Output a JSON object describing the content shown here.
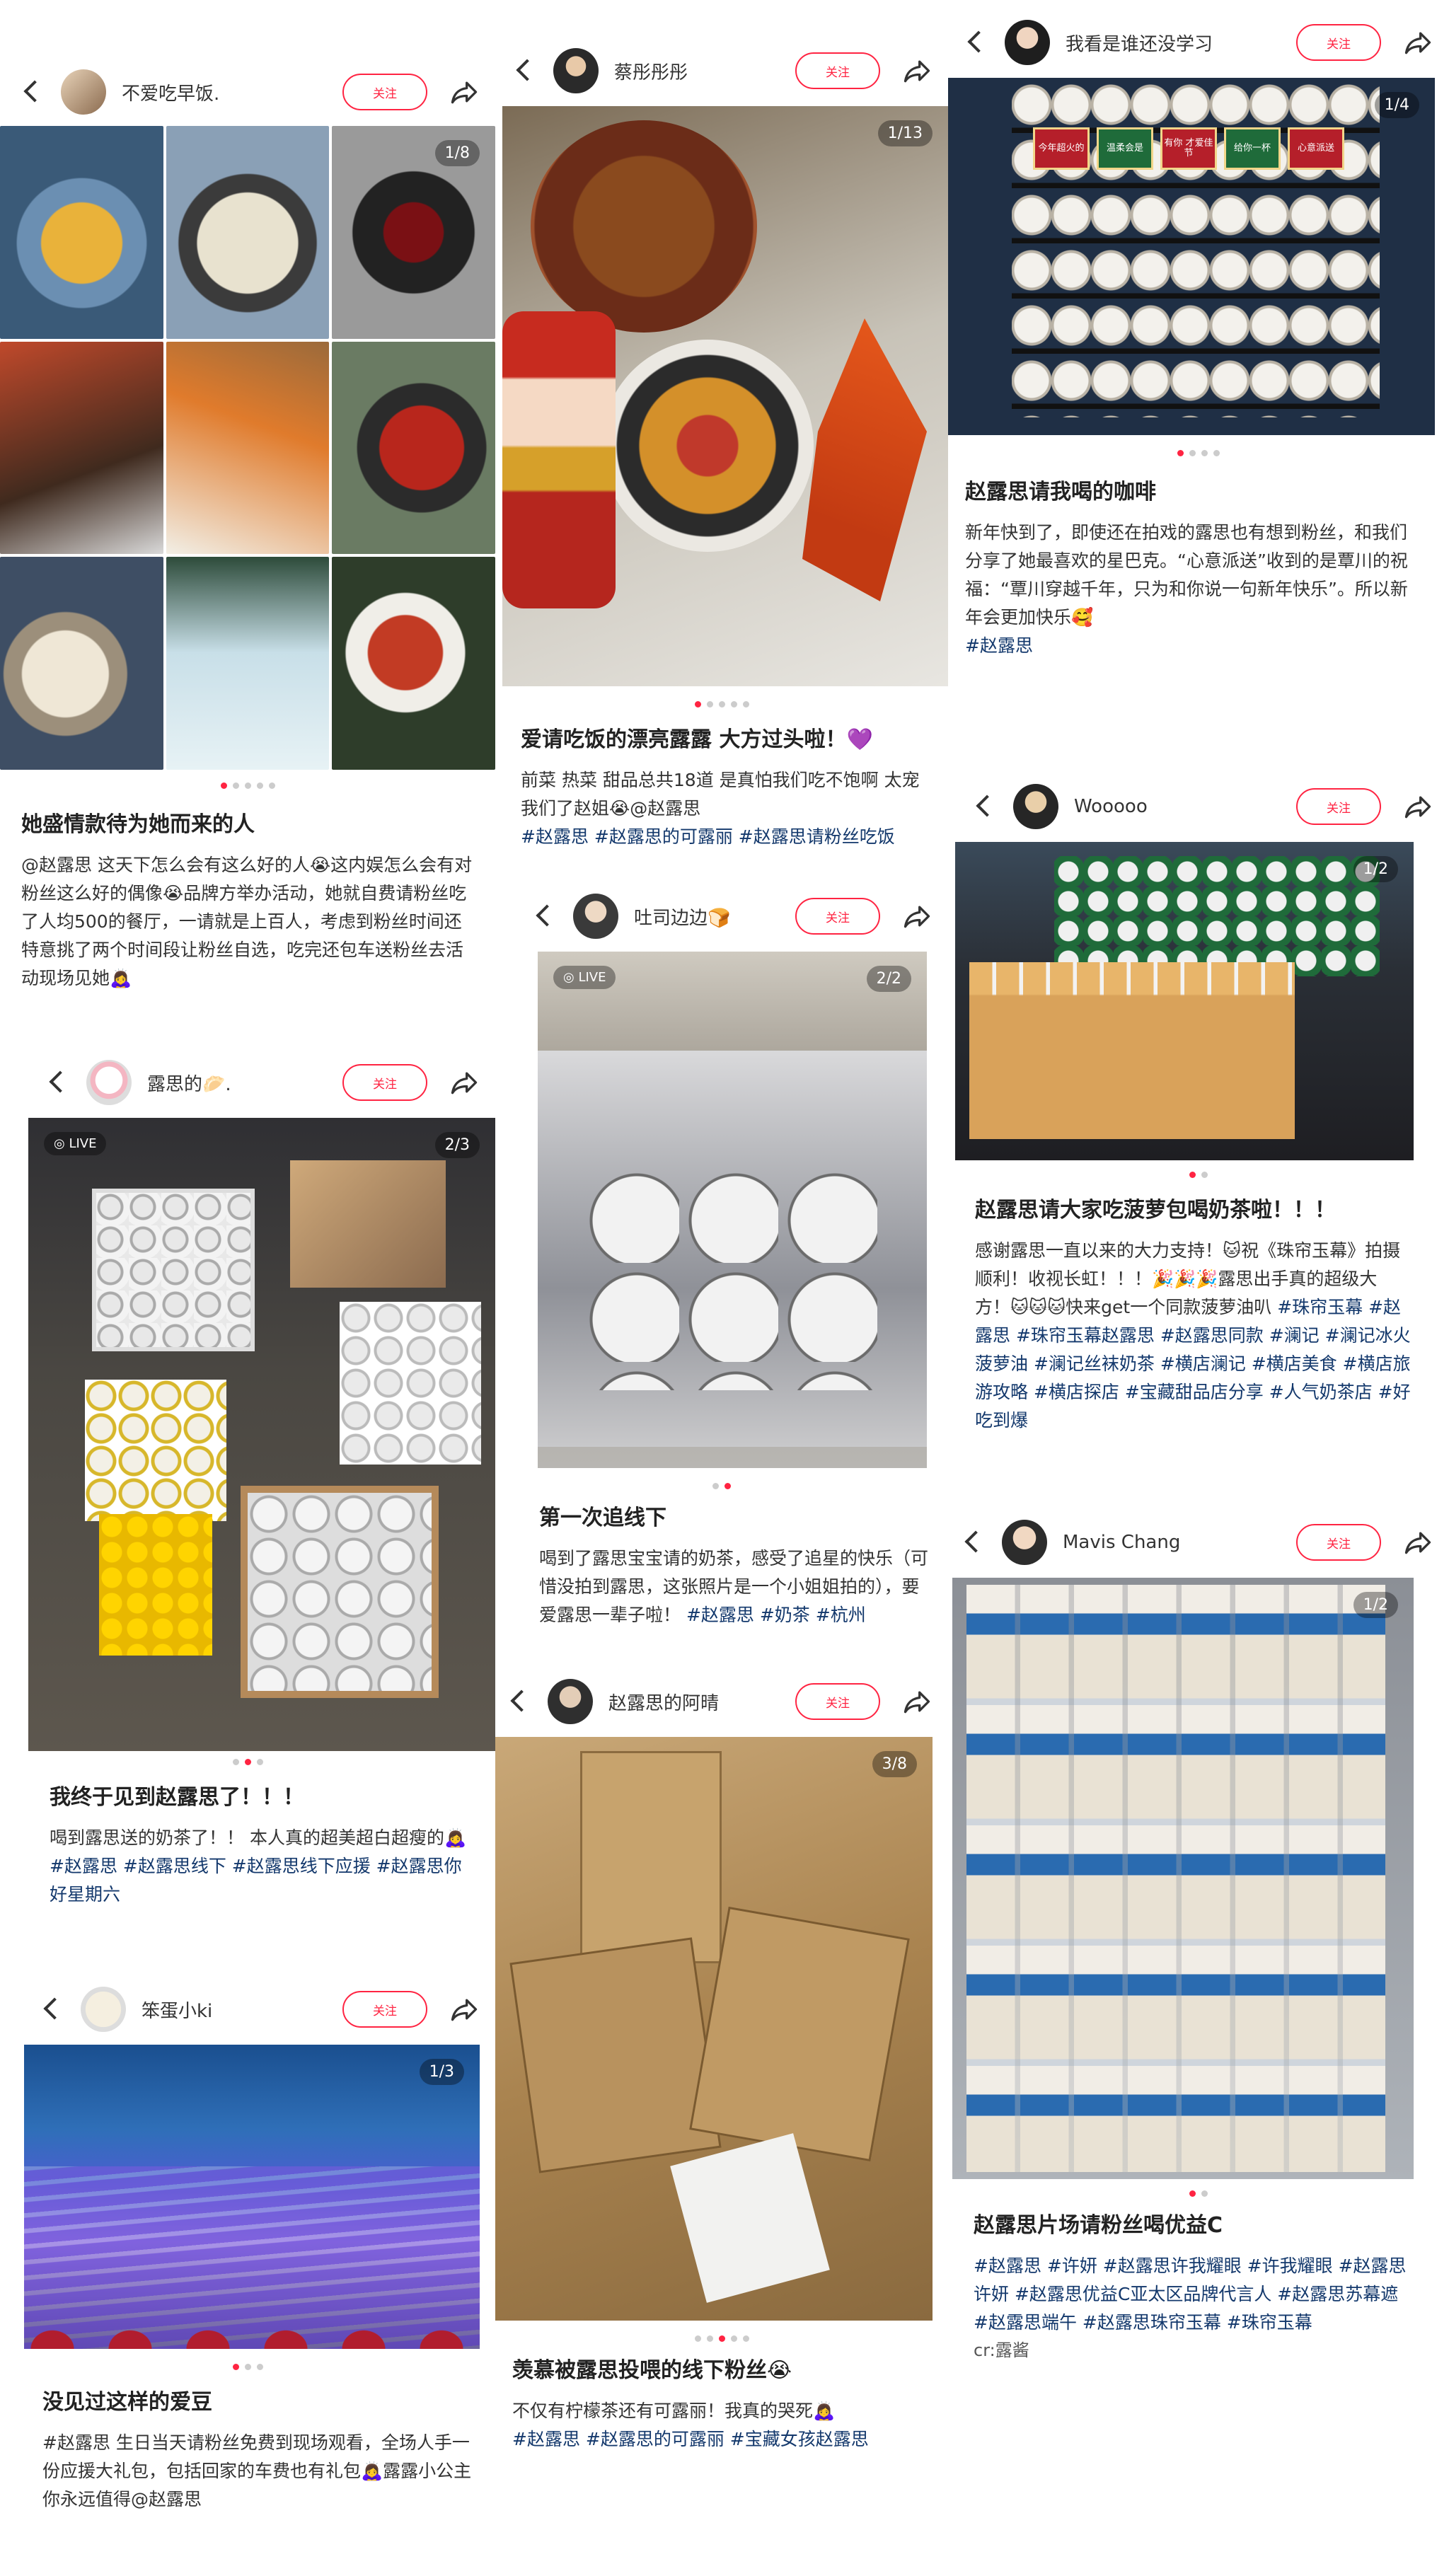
{
  "ui": {
    "follow_label": "关注",
    "live_label": "LIVE"
  },
  "col1": [
    {
      "user": "不爱吃早饭.",
      "counter": "1/8",
      "title": "她盛情款待为她而来的人",
      "text": "@赵露思 这天下怎么会有这么好的人😭这内娱怎么会有对粉丝这么好的偶像😭品牌方举办活动，她就自费请粉丝吃了人均500的餐厅，一请就是上百人，考虑到粉丝时间还特意挑了两个时间段让粉丝自选，吃完还包车送粉丝去活动现场见她🙇‍♀️"
    },
    {
      "user": "露思的🥟.",
      "counter": "2/3",
      "title": "我终于见到赵露思了！！！",
      "text": "喝到露思送的奶茶了！！ 本人真的超美超白超瘦的🙇‍♀️",
      "tags": "#赵露思 #赵露思线下 #赵露思线下应援 #赵露思你好星期六"
    },
    {
      "user": "笨蛋小ki",
      "counter": "1/3",
      "title": "没见过这样的爱豆",
      "text": "#赵露思 生日当天请粉丝免费到现场观看，全场人手一份应援大礼包，包括回家的车费也有礼包🙇‍♀️露露小公主你永远值得@赵露思"
    }
  ],
  "col2": [
    {
      "user": "蔡彤彤彤",
      "counter": "1/13",
      "title": "爱请吃饭的漂亮露露 大方过头啦！💜",
      "text": "前菜 热菜 甜品总共18道 是真怕我们吃不饱啊 太宠我们了赵姐😭@赵露思",
      "tags": "#赵露思 #赵露思的可露丽 #赵露思请粉丝吃饭"
    },
    {
      "user": "吐司边边🍞",
      "counter": "2/2",
      "title": "第一次追线下",
      "text": "喝到了露思宝宝请的奶茶，感受了追星的快乐（可惜没拍到露思，这张照片是一个小姐姐拍的），要爱露思一辈子啦！",
      "tags": "#赵露思 #奶茶 #杭州"
    },
    {
      "user": "赵露思的阿晴",
      "counter": "3/8",
      "title": "羡慕被露思投喂的线下粉丝😭",
      "text": "不仅有柠檬茶还有可露丽！我真的哭死🙇‍♀️",
      "tags": "#赵露思 #赵露思的可露丽 #宝藏女孩赵露思"
    }
  ],
  "col3": [
    {
      "user": "我看是谁还没学习",
      "counter": "1/4",
      "title": "赵露思请我喝的咖啡",
      "text": "新年快到了，即使还在拍戏的露思也有想到粉丝，和我们分享了她最喜欢的星巴克。“心意派送”收到的是覃川的祝福：“覃川穿越千年，只为和你说一句新年快乐”。所以新年会更加快乐🥰",
      "tags": "#赵露思",
      "signs": [
        "今年超火的",
        "温柔会是",
        "有你 才爱佳节",
        "给你一杯",
        "心意派送"
      ]
    },
    {
      "user": "Wooooo",
      "counter": "1/2",
      "title": "赵露思请大家吃菠萝包喝奶茶啦！！！",
      "text": "感谢露思一直以来的大力支持！🐱祝《珠帘玉幕》拍摄顺利！收视长虹！！！🎉🎉🎉露思出手真的超级大方！🐱🐱🐱快来get一个同款菠萝油叭",
      "tags": "#珠帘玉幕 #赵露思 #珠帘玉幕赵露思 #赵露思同款 #澜记 #澜记冰火菠萝油 #澜记丝袜奶茶 #横店澜记 #横店美食 #横店旅游攻略 #横店探店 #宝藏甜品店分享 #人气奶茶店 #好吃到爆"
    },
    {
      "user": "Mavis Chang",
      "counter": "1/2",
      "title": "赵露思片场请粉丝喝优益C",
      "tags": "#赵露思 #许妍 #赵露思许我耀眼 #许我耀眼 #赵露思许妍 #赵露思优益C亚太区品牌代言人 #赵露思苏幕遮 #赵露思端午 #赵露思珠帘玉幕 #珠帘玉幕",
      "credit": "cr:露酱"
    }
  ],
  "colors": {
    "accent": "#ff2442",
    "tag": "#13386c"
  },
  "icons": [
    "back-icon",
    "share-icon",
    "live-icon"
  ]
}
